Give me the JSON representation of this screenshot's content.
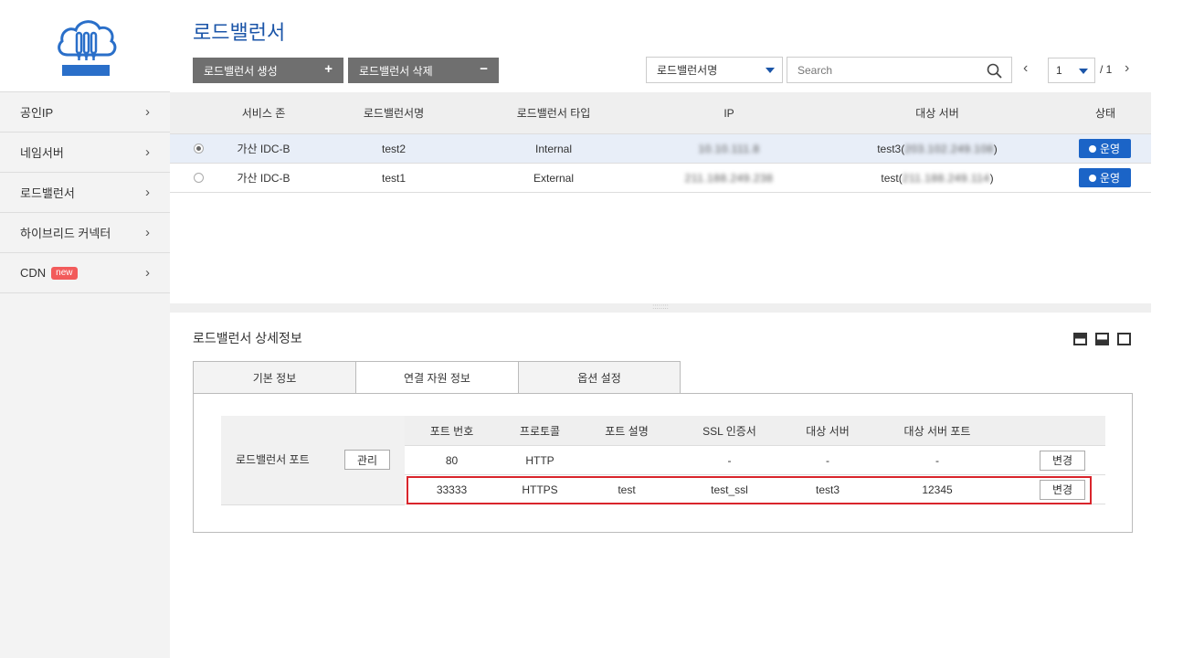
{
  "sidebar": {
    "items": [
      {
        "label": "공인IP"
      },
      {
        "label": "네임서버"
      },
      {
        "label": "로드밸런서"
      },
      {
        "label": "하이브리드 커넥터"
      },
      {
        "label": "CDN",
        "badge": "new"
      }
    ],
    "chevron": "›"
  },
  "header": {
    "title": "로드밸런서",
    "create_label": "로드밸런서 생성",
    "create_symbol": "+",
    "delete_label": "로드밸런서 삭제",
    "delete_symbol": "−",
    "filter_selected": "로드밸런서명",
    "search_placeholder": "Search",
    "page_current": "1",
    "page_total": "/ 1",
    "prev": "‹",
    "next": "›"
  },
  "lb_table": {
    "columns": [
      "서비스 존",
      "로드밸런서명",
      "로드밸런서 타입",
      "IP",
      "대상 서버",
      "상태"
    ],
    "rows": [
      {
        "selected": true,
        "zone": "가산 IDC-B",
        "name": "test2",
        "type": "Internal",
        "ip": "10.10.111.8",
        "target_name": "test3(",
        "target_ip": "203.102.249.108",
        "target_close": ")",
        "status": "운영"
      },
      {
        "selected": false,
        "zone": "가산 IDC-B",
        "name": "test1",
        "type": "External",
        "ip": "211.188.249.238",
        "target_name": "test(",
        "target_ip": "211.188.249.114",
        "target_close": ")",
        "status": "운영"
      }
    ]
  },
  "splitter_grip": "::::::::",
  "detail": {
    "title": "로드밸런서 상세정보",
    "tabs": [
      {
        "label": "기본 정보",
        "active": false
      },
      {
        "label": "연결 자원 정보",
        "active": true
      },
      {
        "label": "옵션 설정",
        "active": false
      }
    ],
    "port_label": "로드밸런서 포트",
    "manage_label": "관리",
    "port_columns": [
      "포트 번호",
      "프로토콜",
      "포트 설명",
      "SSL 인증서",
      "대상 서버",
      "대상 서버 포트"
    ],
    "port_rows": [
      {
        "port": "80",
        "protocol": "HTTP",
        "desc": "",
        "ssl": "-",
        "target": "-",
        "target_port": "-",
        "action": "변경"
      },
      {
        "port": "33333",
        "protocol": "HTTPS",
        "desc": "test",
        "ssl": "test_ssl",
        "target": "test3",
        "target_port": "12345",
        "action": "변경"
      }
    ]
  },
  "colors": {
    "accent": "#1b55a8",
    "status_blue": "#1b64c7",
    "highlight_red": "#d9252c",
    "badge_red": "#f25b5b"
  }
}
